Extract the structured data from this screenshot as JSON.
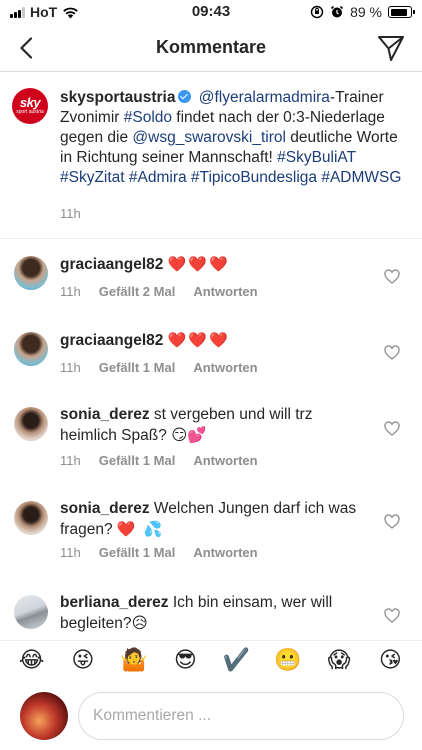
{
  "status_bar": {
    "carrier": "HoT",
    "time": "09:43",
    "battery": "89 %"
  },
  "nav": {
    "title": "Kommentare"
  },
  "caption": {
    "username": "skysportaustria",
    "avatar_text": "sky",
    "avatar_subtext": "sport austria",
    "mention1": "@flyeralarmadmira",
    "text1": "-Trainer Zvonimir ",
    "hashtag_soldo": "#Soldo",
    "text2": " findet nach der 0:3-Niederlage gegen die ",
    "mention2": "@wsg_swarovski_tirol",
    "text3": " deutliche Worte in Richtung seiner Mannschaft! ",
    "hashtags": "#SkyBuliAT #SkyZitat #Admira #TipicoBundesliga #ADMWSG",
    "time": "11h"
  },
  "comments": [
    {
      "username": "graciaangel82",
      "text": "",
      "emoji": "❤️❤️❤️",
      "time": "11h",
      "likes": "Gefällt 2 Mal",
      "reply": "Antworten"
    },
    {
      "username": "graciaangel82",
      "text": "",
      "emoji": "❤️❤️❤️",
      "time": "11h",
      "likes": "Gefällt 1 Mal",
      "reply": "Antworten"
    },
    {
      "username": "sonia_derez",
      "text": "st vergeben und will trz heimlich Spaß?",
      "emoji": "😏💕",
      "time": "11h",
      "likes": "Gefällt 1 Mal",
      "reply": "Antworten"
    },
    {
      "username": "sonia_derez",
      "text": "Welchen Jungen darf ich was fragen?",
      "emoji": "❤️ 💦",
      "time": "11h",
      "likes": "Gefällt 1 Mal",
      "reply": "Antworten"
    },
    {
      "username": "berliana_derez",
      "text": "Ich bin einsam, wer will begleiten?",
      "emoji": "😥",
      "time": "",
      "likes": "",
      "reply": ""
    }
  ],
  "emoji_bar": [
    "😂",
    "😜",
    "🤷",
    "😎",
    "✔️",
    "😬",
    "😱",
    "😘"
  ],
  "input": {
    "placeholder": "Kommentieren ..."
  }
}
